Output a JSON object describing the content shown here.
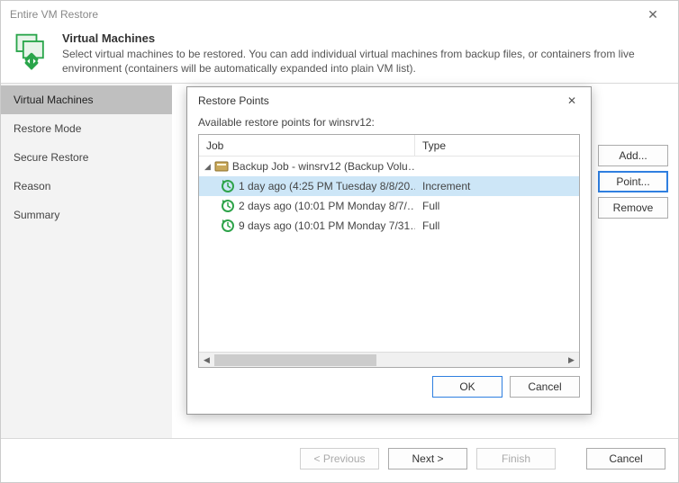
{
  "window": {
    "title": "Entire VM Restore"
  },
  "header": {
    "title": "Virtual Machines",
    "description": "Select virtual machines to be restored. You can add individual virtual machines from backup files, or containers from live environment (containers will be automatically expanded into plain VM list)."
  },
  "sidebar": {
    "items": [
      {
        "label": "Virtual Machines",
        "active": true
      },
      {
        "label": "Restore Mode"
      },
      {
        "label": "Secure Restore"
      },
      {
        "label": "Reason"
      },
      {
        "label": "Summary"
      }
    ]
  },
  "side_buttons": {
    "add": "Add...",
    "point": "Point...",
    "remove": "Remove"
  },
  "footer": {
    "previous": "< Previous",
    "next": "Next >",
    "finish": "Finish",
    "cancel": "Cancel"
  },
  "modal": {
    "title": "Restore Points",
    "caption": "Available restore points for winsrv12:",
    "columns": {
      "job": "Job",
      "type": "Type"
    },
    "ok": "OK",
    "cancel": "Cancel",
    "tree": {
      "job_label": "Backup Job - winsrv12 (Backup Volu…",
      "points": [
        {
          "label": "1 day ago (4:25 PM Tuesday 8/8/20…",
          "type": "Increment",
          "selected": true
        },
        {
          "label": "2 days ago (10:01 PM Monday 8/7/…",
          "type": "Full"
        },
        {
          "label": "9 days ago (10:01 PM Monday 7/31…",
          "type": "Full"
        }
      ]
    }
  }
}
